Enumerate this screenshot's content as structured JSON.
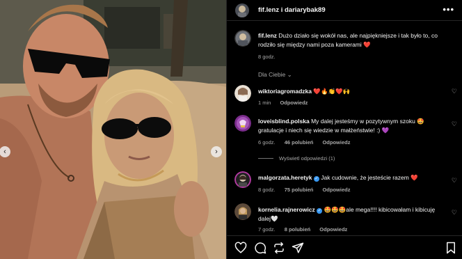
{
  "header": {
    "names": "fif.lenz i dariarybak89",
    "more_label": "•••"
  },
  "caption": {
    "username": "fif.lenz",
    "text": "Dużo działo się wokół nas, ale najpiękniejsze i tak było to, co rodziło się między nami poza kamerami",
    "emoji": "❤️",
    "time": "8 godz."
  },
  "sort_label": "Dla Ciebie ⌄",
  "comments": [
    {
      "username": "wiktoriagromadzka",
      "verified": false,
      "text": "❤️🔥👏❤️🙌",
      "time": "1 min",
      "likes": "",
      "reply": "Odpowiedz"
    },
    {
      "username": "loveisblind.polska",
      "verified": false,
      "text": "My dalej jesteśmy w pozytywnym szoku 🤩 gratulacje i niech się wiedzie w małżeństwie! :) 💜",
      "time": "6 godz.",
      "likes": "46 polubień",
      "reply": "Odpowiedz"
    },
    {
      "username": "malgorzata.heretyk",
      "verified": true,
      "text": "Jak cudownie, że jesteście razem ❤️",
      "time": "8 godz.",
      "likes": "75 polubień",
      "reply": "Odpowiedz"
    },
    {
      "username": "kornelia.rajnerowicz",
      "verified": true,
      "text": "🤩🤩🤩ale mega!!!! kibicowałam i kibicuję dalej🤍",
      "time": "7 godz.",
      "likes": "8 polubień",
      "reply": "Odpowiedz"
    }
  ],
  "view_replies": "Wyświetl odpowiedzi (1)",
  "actions": [
    "heart-icon",
    "comment-icon",
    "repost-icon",
    "share-icon",
    "save-icon"
  ],
  "colors": {
    "verified": "#3797f0",
    "heart": "#ff3040",
    "muted": "#a8a8a8"
  }
}
